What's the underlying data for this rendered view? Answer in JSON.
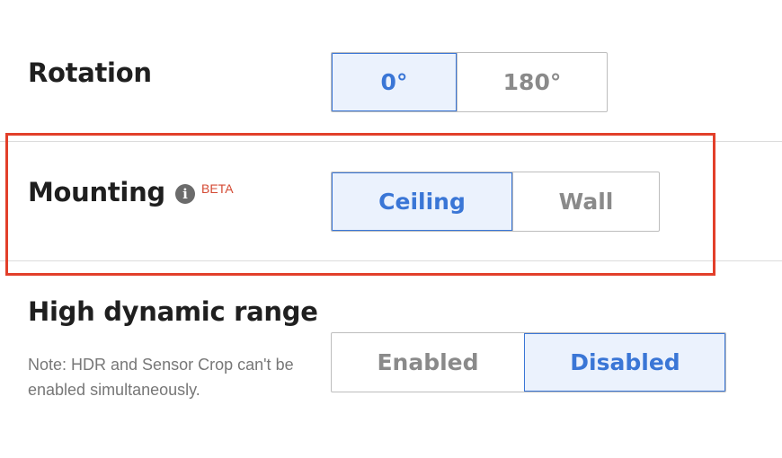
{
  "rotation": {
    "label": "Rotation",
    "options": [
      "0°",
      "180°"
    ],
    "selected": "0°"
  },
  "mounting": {
    "label": "Mounting",
    "info_icon": "info-icon",
    "badge": "BETA",
    "options": [
      "Ceiling",
      "Wall"
    ],
    "selected": "Ceiling"
  },
  "hdr": {
    "label": "High dynamic range",
    "note": "Note: HDR and Sensor Crop can't be enabled simultaneously.",
    "options": [
      "Enabled",
      "Disabled"
    ],
    "selected": "Disabled"
  },
  "colors": {
    "accent": "#3a76d6",
    "highlight_border": "#e23f2a",
    "beta": "#d44a33"
  }
}
